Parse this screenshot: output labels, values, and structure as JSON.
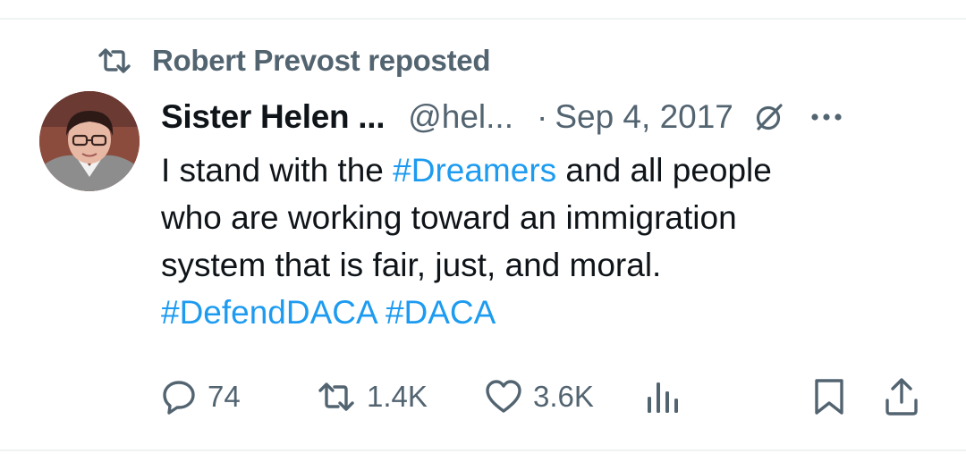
{
  "repost": {
    "text": "Robert Prevost reposted",
    "icon": "repost-icon"
  },
  "author": {
    "display_name": "Sister Helen ...",
    "handle": "@hel...",
    "separator": "·",
    "date": "Sep 4, 2017",
    "avatar_icon": "avatar"
  },
  "tweet": {
    "line1_pre": "I stand with the ",
    "line1_tag": "#Dreamers",
    "line1_post": " and all people",
    "line2": "who are working toward an immigration",
    "line3": "system that is fair, just, and moral.",
    "tag_defend": "#DefendDACA",
    "tag_daca": "#DACA"
  },
  "actions": {
    "replies": "74",
    "reposts": "1.4K",
    "likes": "3.6K"
  },
  "colors": {
    "text": "#0f1419",
    "muted": "#536471",
    "link": "#1d9bf0",
    "divider": "#eff3f4"
  }
}
